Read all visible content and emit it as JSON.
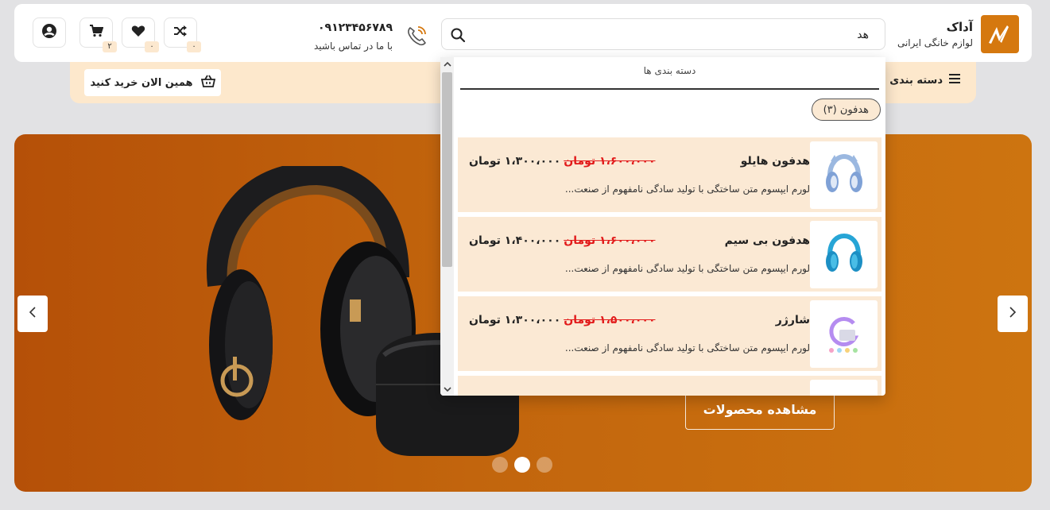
{
  "brand": {
    "name": "آداک",
    "tagline": "لوازم خانگی ایرانی"
  },
  "search": {
    "value": "هد",
    "placeholder": ""
  },
  "contact": {
    "phone": "۰۹۱۲۳۴۵۶۷۸۹",
    "label": "با ما در تماس باشید"
  },
  "header_actions": {
    "compare_count": "۰",
    "wishlist_count": "۰",
    "cart_count": "۲"
  },
  "catbar": {
    "categories_label": "دسته بندی محصولات",
    "buy_now_label": "همین الان خرید کنید"
  },
  "dropdown": {
    "title": "دسته بندی ها",
    "category_chip": "هدفون (۳)",
    "results": [
      {
        "name": "هدفون هایلو",
        "old_price": "۱،۶۰۰،۰۰۰ تومان",
        "new_price": "۱،۳۰۰،۰۰۰ تومان",
        "desc": "لورم ایپسوم متن ساختگی با تولید سادگی نامفهوم از صنعت..."
      },
      {
        "name": "هدفون بی سیم",
        "old_price": "۱،۶۰۰،۰۰۰ تومان",
        "new_price": "۱،۴۰۰،۰۰۰ تومان",
        "desc": "لورم ایپسوم متن ساختگی با تولید سادگی نامفهوم از صنعت..."
      },
      {
        "name": "شارژر",
        "old_price": "۱،۵۰۰،۰۰۰ تومان",
        "new_price": "۱،۳۰۰،۰۰۰ تومان",
        "desc": "لورم ایپسوم متن ساختگی با تولید سادگی نامفهوم از صنعت..."
      }
    ]
  },
  "hero": {
    "cta_label": "مشاهده محصولات",
    "active_slide": 2
  },
  "colors": {
    "accent": "#d5780f",
    "catbar": "#fde8cc",
    "sale": "#e21b1b",
    "hero_start": "#b55008",
    "hero_end": "#cd7410"
  }
}
